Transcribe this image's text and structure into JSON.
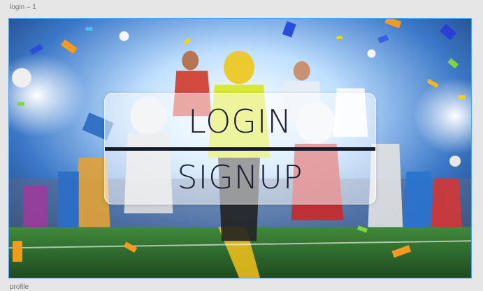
{
  "artboards": {
    "top_label": "login – 1",
    "bottom_label": "profile"
  },
  "hero": {
    "image_desc_icon": "sports-collage-image"
  },
  "panel": {
    "login_label": "LOGIN",
    "signup_label": "SIGNUP"
  },
  "colors": {
    "selection_border": "#4aa3f0",
    "divider": "#151a2a",
    "button_text": "#1a1f33"
  }
}
